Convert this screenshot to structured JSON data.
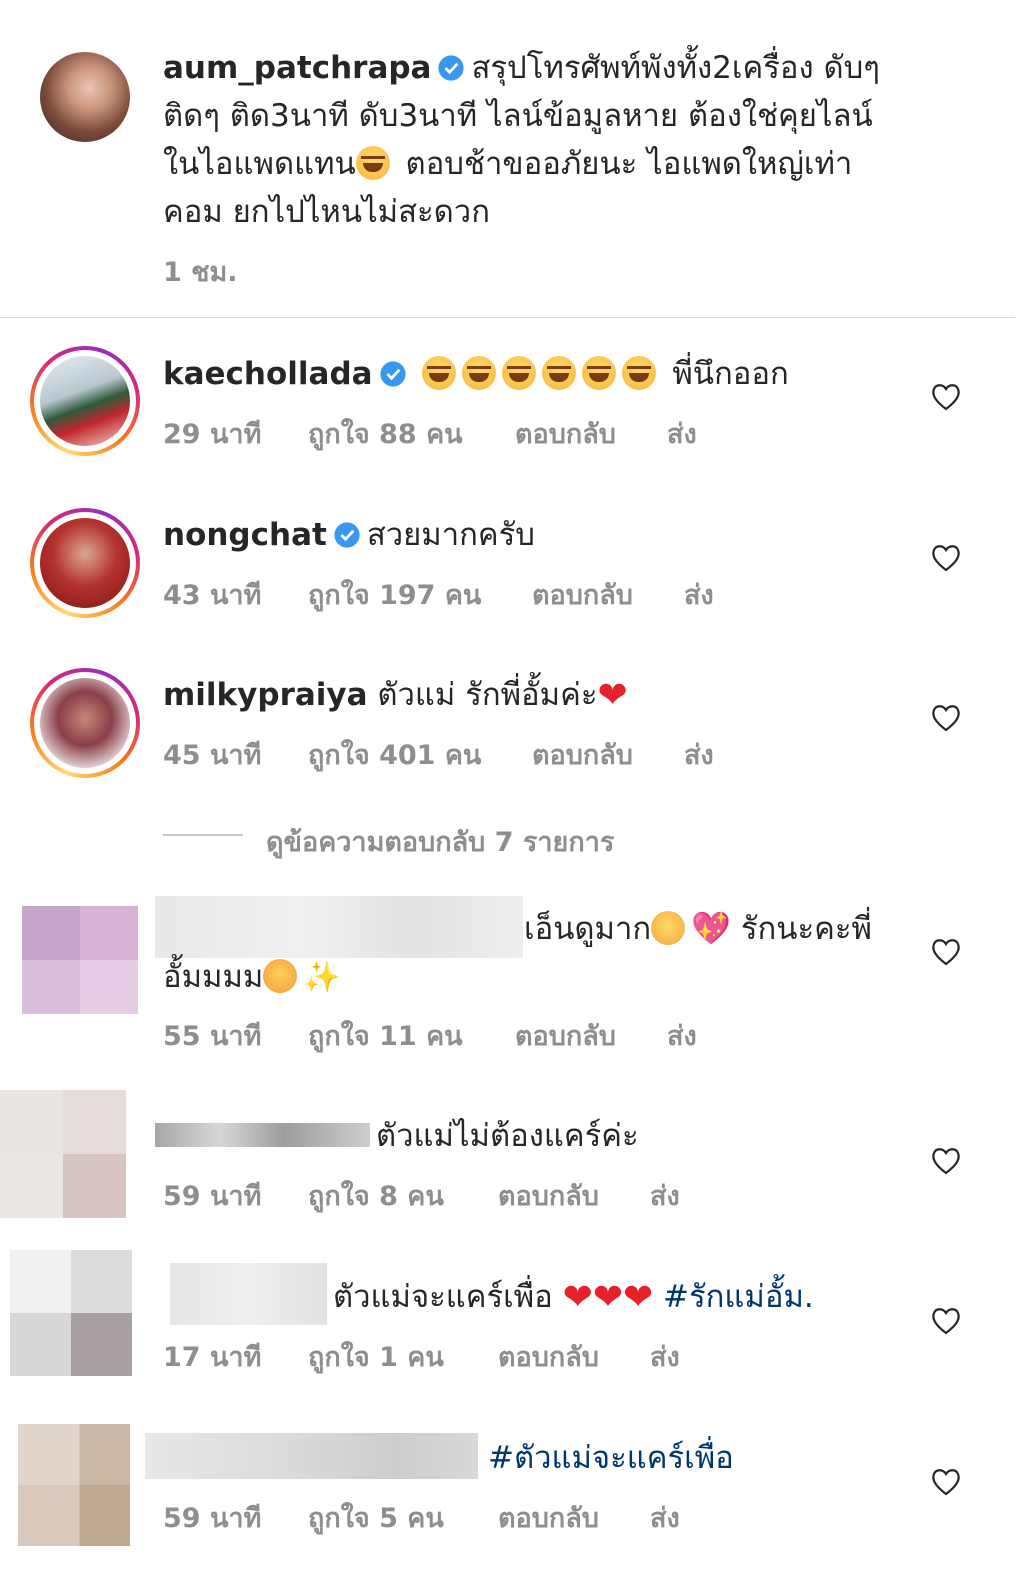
{
  "caption": {
    "username": "aum_patchrapa",
    "lines": [
      "สรุปโทรศัพท์พังทั้ง2เครื่อง ดับๆ",
      "ติดๆ ติด3นาที ดับ3นาที  ไลน์ข้อมูลหาย ต้องใช่คุยไลน์",
      "ในไอแพดแทน",
      " ตอบช้าขออภัยนะ ไอแพดใหญ่เท่า",
      "คอม ยกไปไหนไม่สะดวก"
    ],
    "time": "1 ชม."
  },
  "comments": [
    {
      "username": "kaechollada",
      "verified": true,
      "text": "พี่นึกออก",
      "emoji": [
        "laugh-emoji",
        "laugh-emoji",
        "laugh-emoji",
        "laugh-emoji",
        "laugh-emoji",
        "laugh-emoji"
      ],
      "time": "29 นาที",
      "likes": "ถูกใจ 88 คน",
      "reply": "ตอบกลับ",
      "send": "ส่ง"
    },
    {
      "username": "nongchat",
      "verified": true,
      "text": "สวยมากครับ",
      "time": "43 นาที",
      "likes": "ถูกใจ 197 คน",
      "reply": "ตอบกลับ",
      "send": "ส่ง"
    },
    {
      "username": "milkypraiya",
      "verified": false,
      "text": "ตัวแม่ รักพี่อั้มค่ะ",
      "time": "45 นาที",
      "likes": "ถูกใจ 401 คน",
      "reply": "ตอบกลับ",
      "send": "ส่ง"
    }
  ],
  "view_replies": "ดูข้อความตอบกลับ 7 รายการ",
  "replies": [
    {
      "text_line1": "เอ็นดูมาก",
      "text_line1b": " รักนะคะพี่",
      "text_line2": "อั้มมมม",
      "time": "55 นาที",
      "likes": "ถูกใจ 11 คน",
      "reply": "ตอบกลับ",
      "send": "ส่ง"
    },
    {
      "text": "ตัวแม่ไม่ต้องแคร์ค่ะ",
      "time": "59 นาที",
      "likes": "ถูกใจ 8 คน",
      "reply": "ตอบกลับ",
      "send": "ส่ง"
    },
    {
      "text": "ตัวแม่จะแคร์เพื่อ ",
      "hashtag": "#รักแม่อั้ม.",
      "time": "17 นาที",
      "likes": "ถูกใจ 1 คน",
      "reply": "ตอบกลับ",
      "send": "ส่ง"
    },
    {
      "hashtag": "#ตัวแม่จะแคร์เพื่อ",
      "time": "59 นาที",
      "likes": "ถูกใจ 5 คน",
      "reply": "ตอบกลับ",
      "send": "ส่ง"
    }
  ],
  "colors": {
    "verified_blue": "#3897f0",
    "meta_gray": "#8e8e8e",
    "hashtag_blue": "#00376b",
    "heart_red": "#e8202a"
  }
}
